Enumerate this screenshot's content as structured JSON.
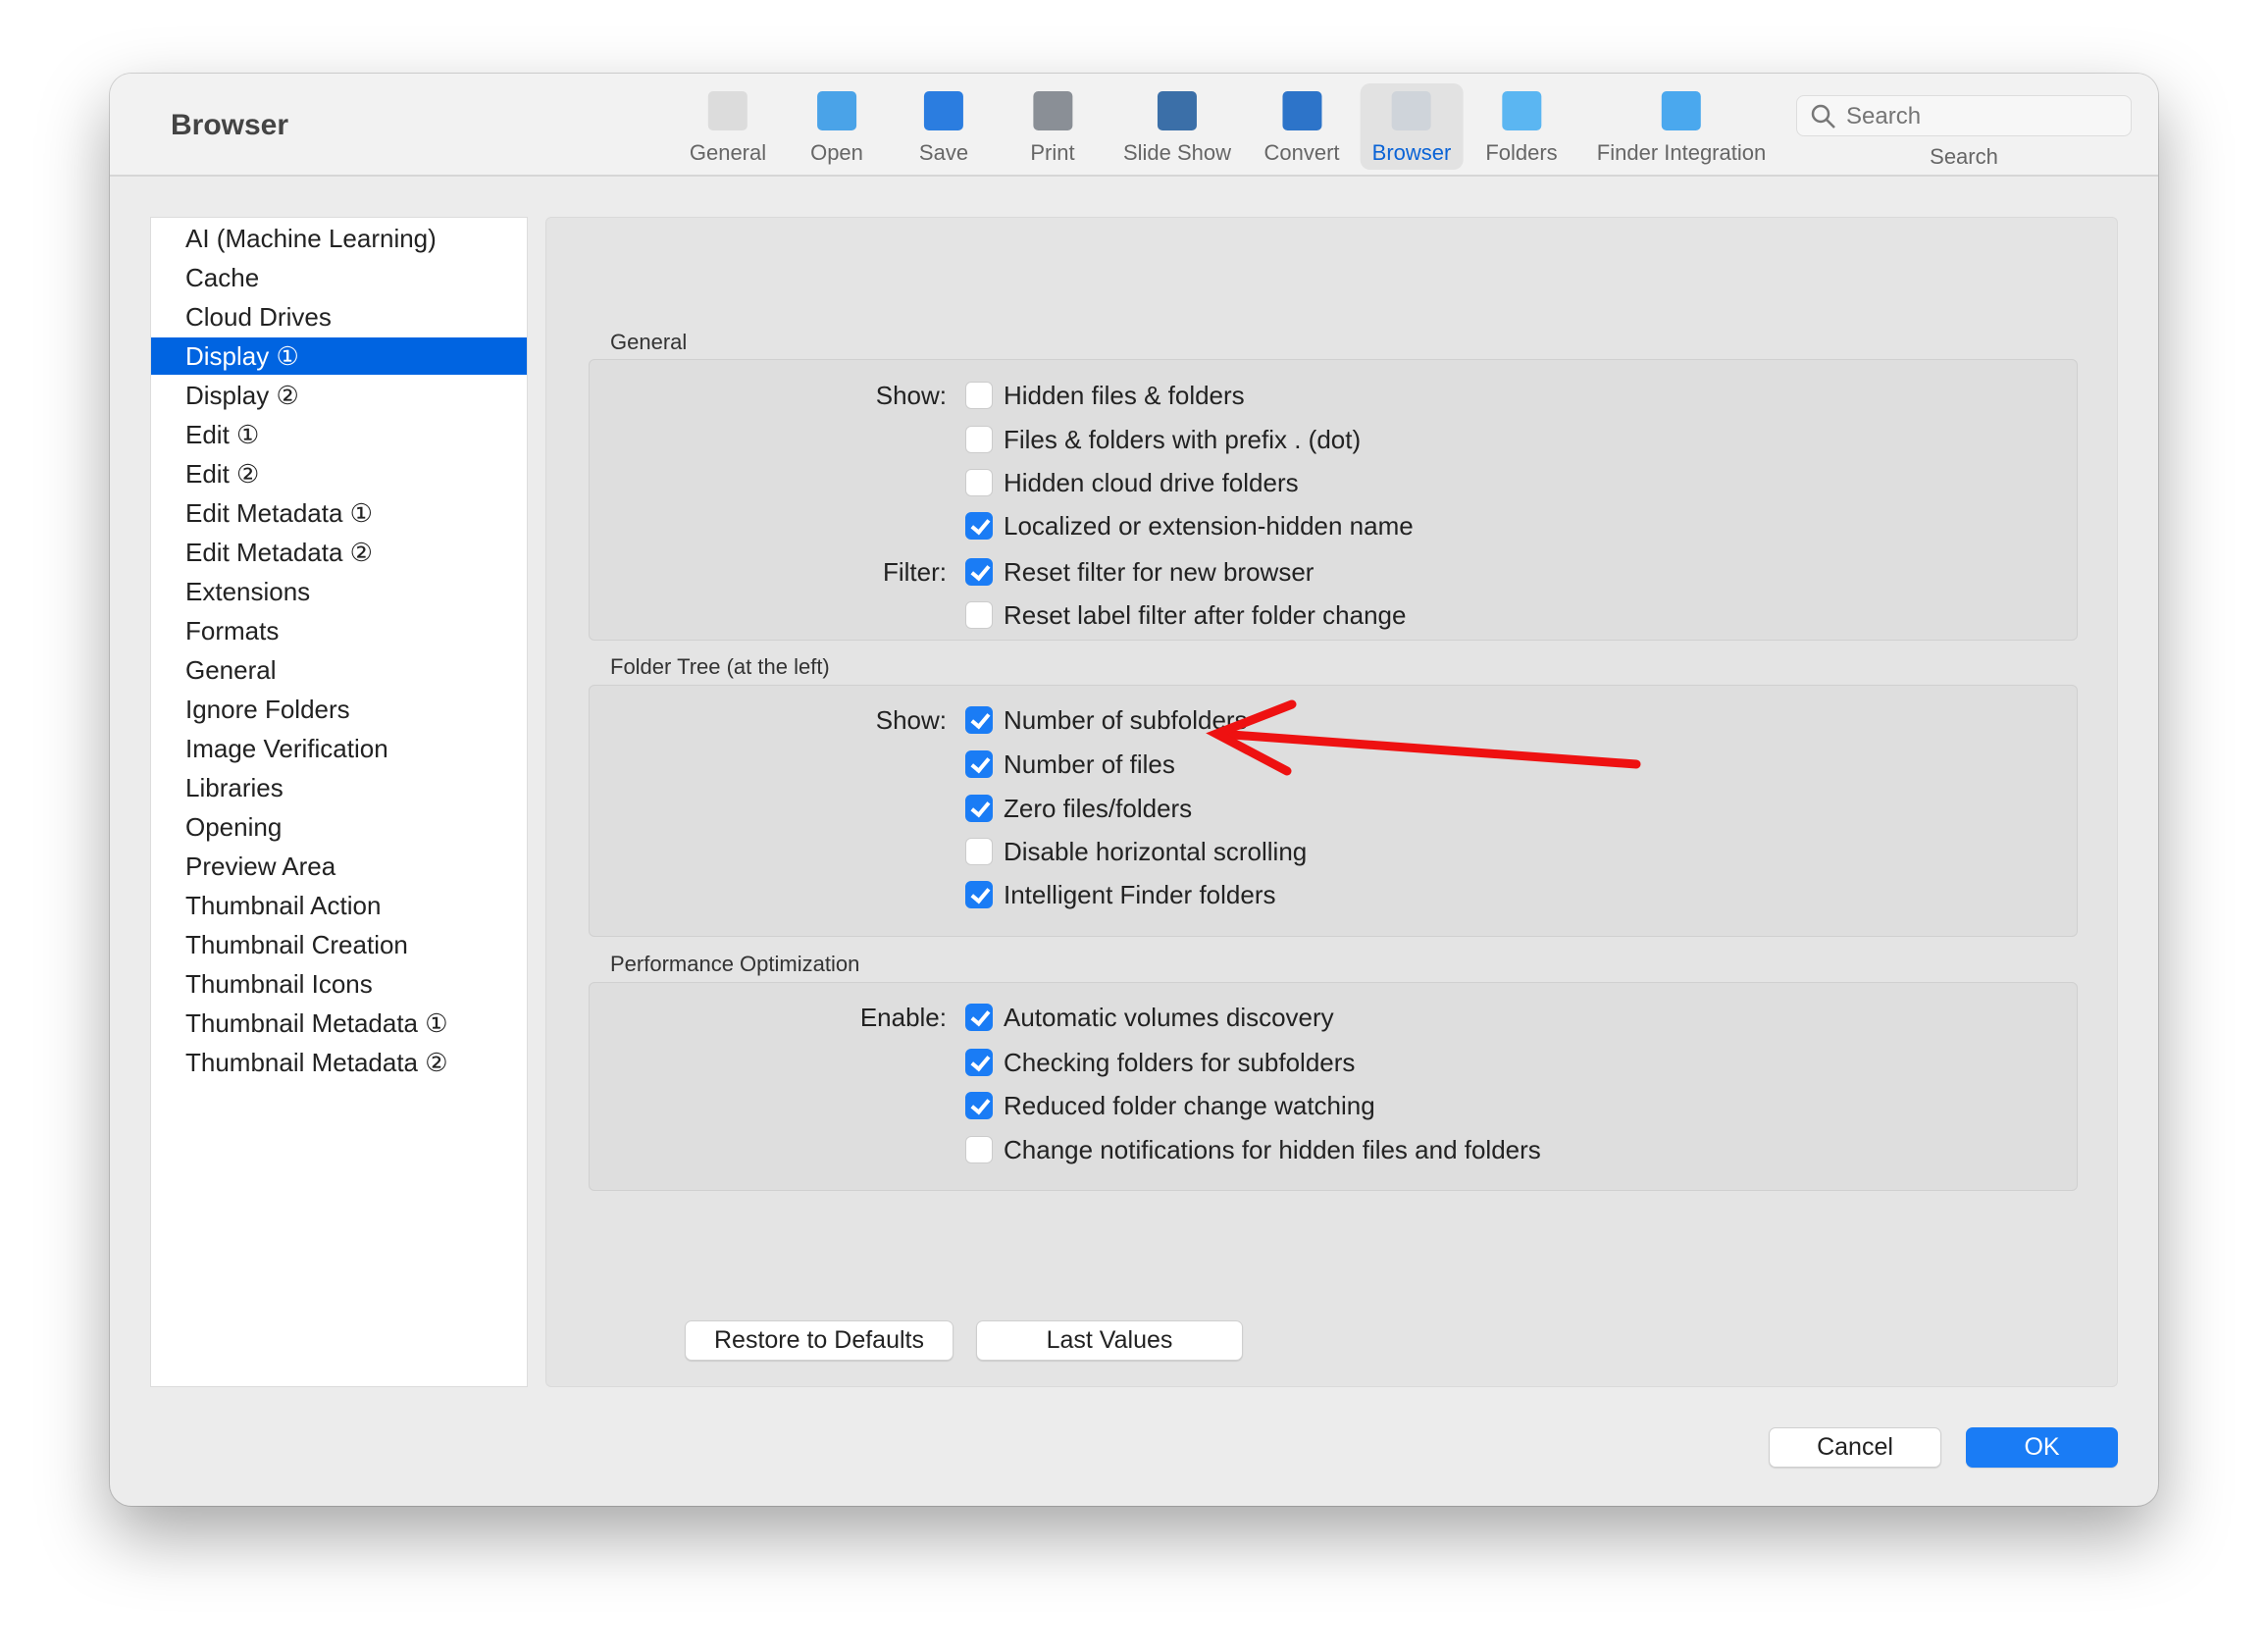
{
  "window": {
    "title": "Browser"
  },
  "toolbar": {
    "items": [
      {
        "label": "General",
        "icon": "switch-icon",
        "color": "#dcdcdc"
      },
      {
        "label": "Open",
        "icon": "folder-brush-icon",
        "color": "#4aa3e8"
      },
      {
        "label": "Save",
        "icon": "file-formats-icon",
        "color": "#2b7de0"
      },
      {
        "label": "Print",
        "icon": "printer-icon",
        "color": "#8a8f96"
      },
      {
        "label": "Slide Show",
        "icon": "slideshow-icon",
        "color": "#3b6fa8"
      },
      {
        "label": "Convert",
        "icon": "convert-icon",
        "color": "#2d74c9"
      },
      {
        "label": "Browser",
        "icon": "browser-icon",
        "color": "#cfd4da"
      },
      {
        "label": "Folders",
        "icon": "folder-photo-icon",
        "color": "#5bb6f2"
      },
      {
        "label": "Finder Integration",
        "icon": "folder-ext-icon",
        "color": "#4aa8ee"
      }
    ],
    "selected": "Browser",
    "search": {
      "placeholder": "Search",
      "label": "Search"
    }
  },
  "sidebar": {
    "items": [
      "AI (Machine Learning)",
      "Cache",
      "Cloud Drives",
      "Display ①",
      "Display ②",
      "Edit ①",
      "Edit ②",
      "Edit Metadata ①",
      "Edit Metadata ②",
      "Extensions",
      "Formats",
      "General",
      "Ignore Folders",
      "Image Verification",
      "Libraries",
      "Opening",
      "Preview Area",
      "Thumbnail Action",
      "Thumbnail Creation",
      "Thumbnail Icons",
      "Thumbnail Metadata ①",
      "Thumbnail Metadata ②"
    ],
    "selected": "Display ①"
  },
  "groups": [
    {
      "title": "General",
      "rows": [
        {
          "label": "Show:",
          "text": "Hidden files & folders",
          "checked": false
        },
        {
          "label": "",
          "text": "Files & folders with prefix . (dot)",
          "checked": false
        },
        {
          "label": "",
          "text": "Hidden cloud drive folders",
          "checked": false
        },
        {
          "label": "",
          "text": "Localized or extension-hidden name",
          "checked": true
        },
        {
          "label": "Filter:",
          "text": "Reset filter for new browser",
          "checked": true
        },
        {
          "label": "",
          "text": "Reset label filter after folder change",
          "checked": false
        }
      ]
    },
    {
      "title": "Folder Tree (at the left)",
      "rows": [
        {
          "label": "Show:",
          "text": "Number of subfolders",
          "checked": true
        },
        {
          "label": "",
          "text": "Number of files",
          "checked": true
        },
        {
          "label": "",
          "text": "Zero files/folders",
          "checked": true
        },
        {
          "label": "",
          "text": "Disable horizontal scrolling",
          "checked": false
        },
        {
          "label": "",
          "text": "Intelligent Finder folders",
          "checked": true
        }
      ]
    },
    {
      "title": "Performance Optimization",
      "rows": [
        {
          "label": "Enable:",
          "text": "Automatic volumes discovery",
          "checked": true
        },
        {
          "label": "",
          "text": "Checking folders for subfolders",
          "checked": true
        },
        {
          "label": "",
          "text": "Reduced folder change watching",
          "checked": true
        },
        {
          "label": "",
          "text": "Change notifications for hidden files and folders",
          "checked": false
        }
      ]
    }
  ],
  "buttons": {
    "restore": "Restore to Defaults",
    "last": "Last Values",
    "cancel": "Cancel",
    "ok": "OK"
  },
  "colors": {
    "accent": "#0064e1",
    "checkbox": "#1a7cf5",
    "annotation_arrow": "#ee1111"
  }
}
